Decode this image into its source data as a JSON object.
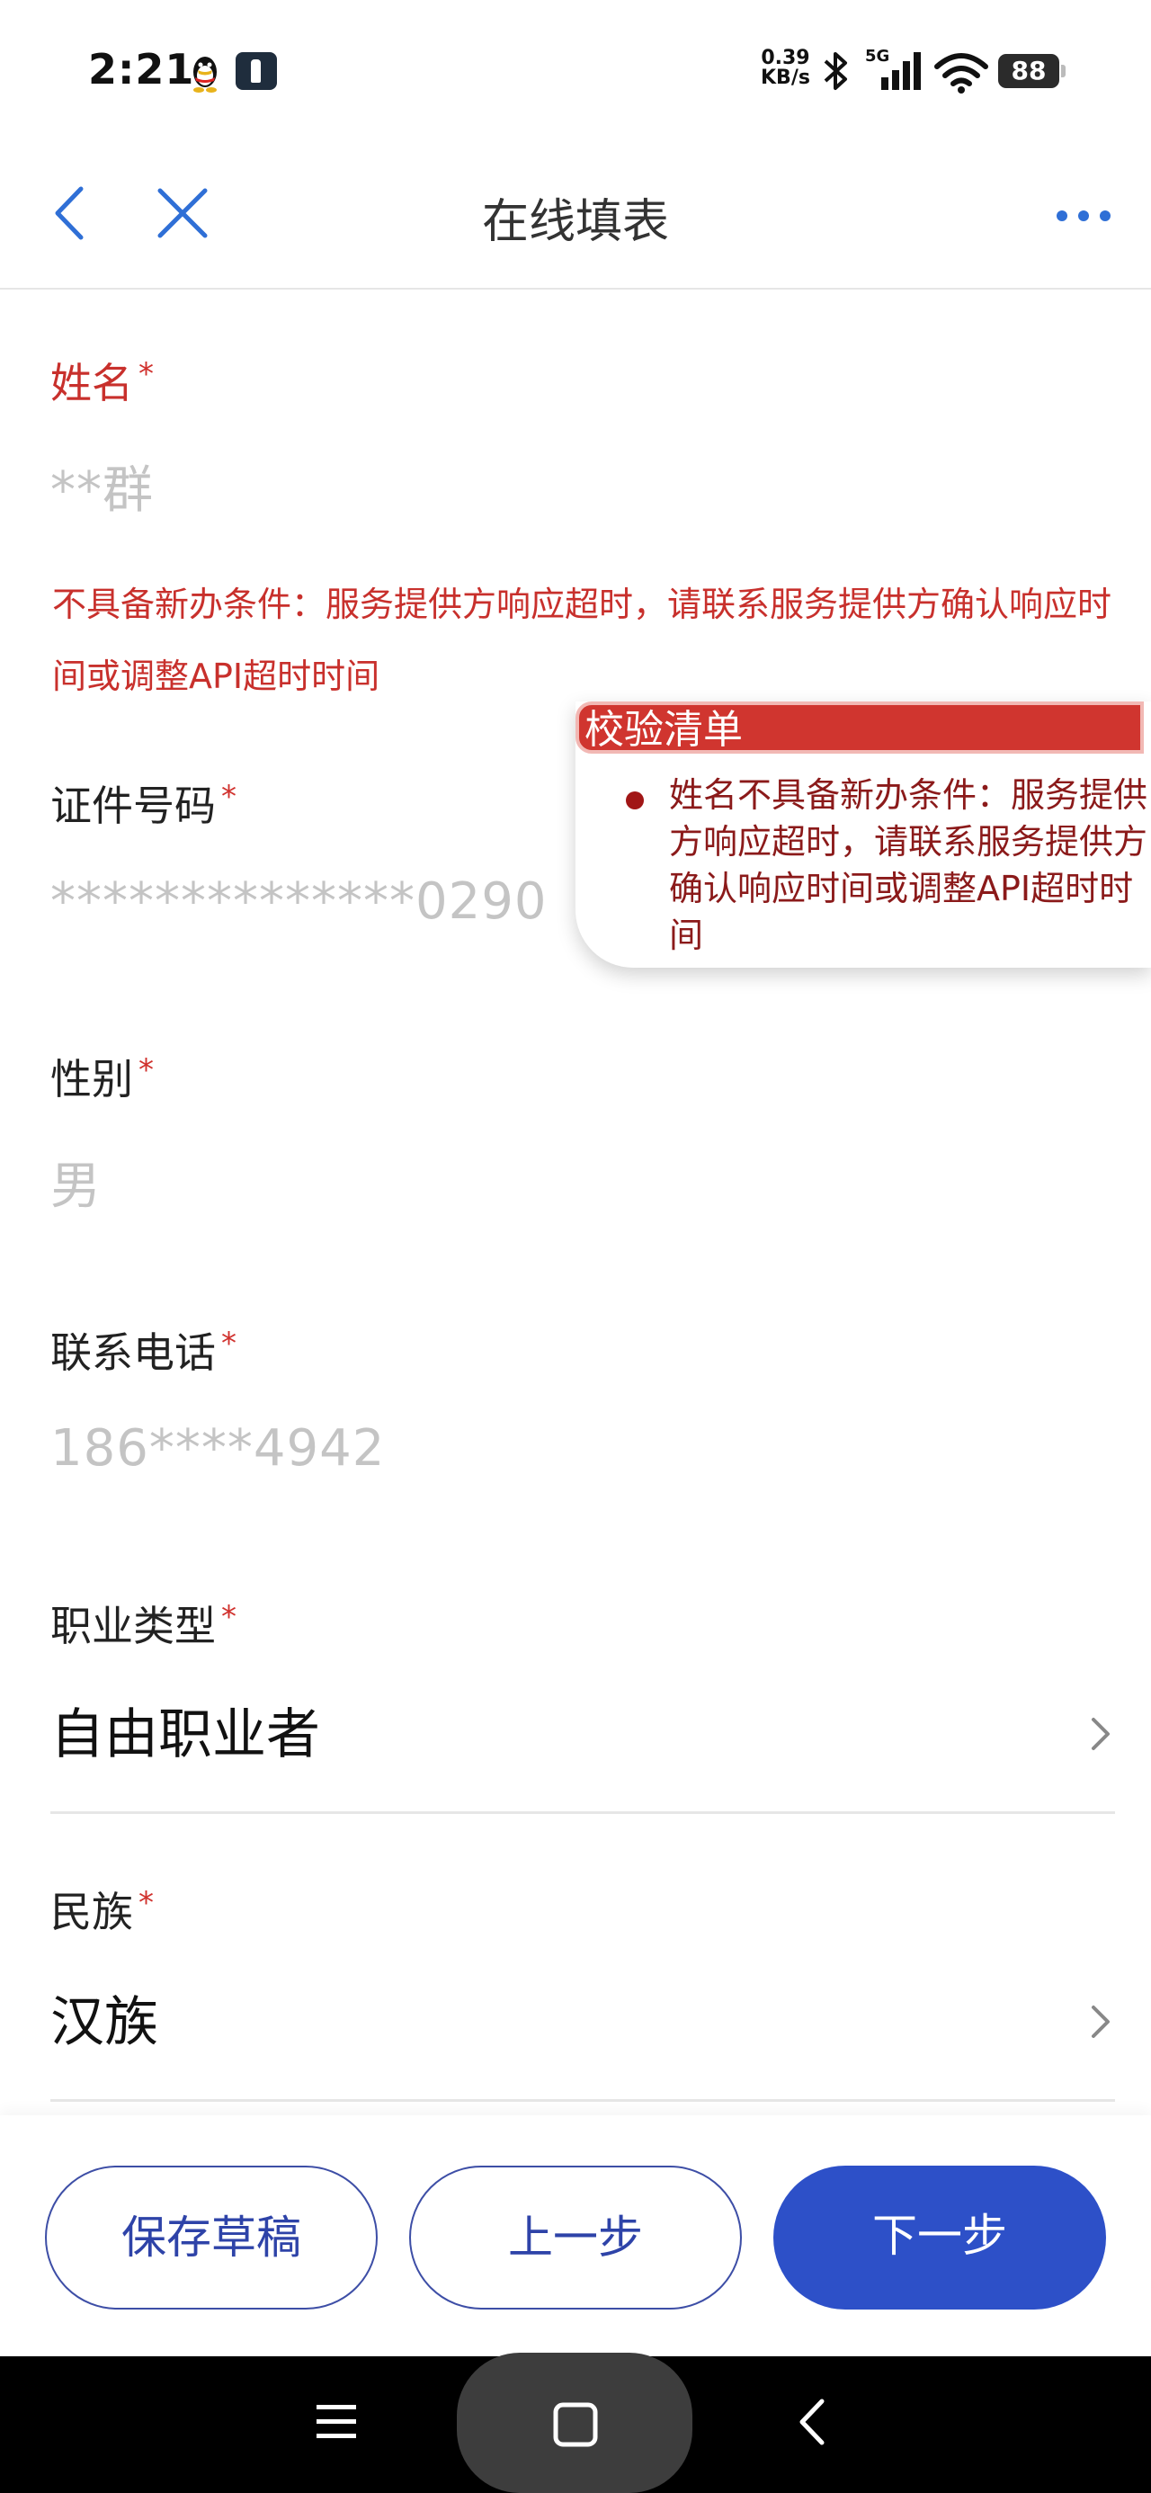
{
  "status_bar": {
    "time": "2:21",
    "speed_value": "0.39",
    "speed_unit": "KB/s",
    "network": "5G",
    "battery": "88"
  },
  "nav": {
    "title": "在线填表"
  },
  "form": {
    "required_mark": "*",
    "name": {
      "label": "姓名",
      "value": "**群"
    },
    "name_error": "不具备新办条件：服务提供方响应超时，请联系服务提供方确认响应时间或调整API超时时间",
    "id_number": {
      "label": "证件号码",
      "value": "**************0290"
    },
    "gender": {
      "label": "性别",
      "value": "男"
    },
    "phone": {
      "label": "联系电话",
      "value": "186****4942"
    },
    "occupation": {
      "label": "职业类型",
      "value": "自由职业者"
    },
    "ethnicity": {
      "label": "民族",
      "value": "汉族"
    }
  },
  "validation_popup": {
    "title": "校验清单",
    "items": [
      "姓名不具备新办条件：服务提供方响应超时，请联系服务提供方确认响应时间或调整API超时时间"
    ]
  },
  "actions": {
    "save_draft": "保存草稿",
    "previous": "上一步",
    "next": "下一步"
  },
  "colors": {
    "error": "#c8302c",
    "primary": "#2d50c8",
    "nav_icon": "#2f6fd6"
  }
}
